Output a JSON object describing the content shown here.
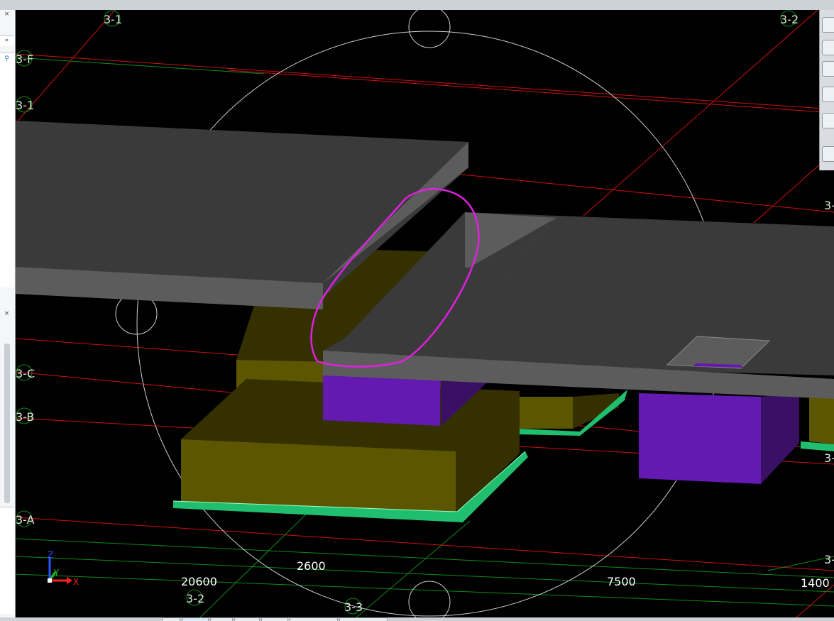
{
  "window": {
    "close_glyph_top": "×",
    "expand_glyph": "»",
    "search_glyph": "⚲",
    "close_glyph_lower": "×"
  },
  "grid_labels": {
    "top_left": "3-1",
    "top_right": "3-2",
    "f": "3-F",
    "one": "3-1",
    "c": "3-C",
    "b": "3-B",
    "a": "3-A",
    "bottom_left": "3-2",
    "bottom_mid": "3-3",
    "right_upper": "3-",
    "right_mid": "3-",
    "right_lower": "3-"
  },
  "dimensions": {
    "d1": "20600",
    "d2": "2600",
    "d3": "7500",
    "d4": "1400"
  },
  "axis": {
    "z": "Z",
    "y": "Y",
    "x": "X"
  },
  "colors": {
    "viewport_bg": "#000000",
    "slab_top": "#3a3a3a",
    "slab_edge": "#5c5c5c",
    "footing_front": "#5c5600",
    "footing_top": "#343000",
    "pedestal_front": "#6419b0",
    "pedestal_side": "#3a1065",
    "base_plate": "#1fbf6f",
    "grid_red": "#d01010",
    "grid_green": "#0e8a1a",
    "annotation": "#e020e0"
  },
  "icons": [
    "close-icon",
    "expand-icon",
    "search-icon",
    "navigation-wheel-icon",
    "view-cube-icon",
    "pan-icon",
    "zoom-icon",
    "orbit-icon",
    "settings-icon"
  ]
}
